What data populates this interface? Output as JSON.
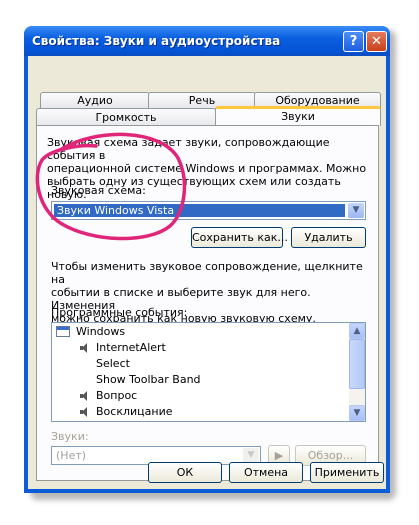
{
  "window": {
    "title": "Свойства: Звуки и аудиоустройства",
    "help_glyph": "?",
    "close_glyph": "✕"
  },
  "tabs": {
    "row_back": [
      "Аудио",
      "Речь",
      "Оборудование"
    ],
    "row_front": [
      "Громкость",
      "Звуки"
    ],
    "active": "Звуки"
  },
  "sounds_tab": {
    "intro": [
      "Звуковая схема задает звуки, сопровождающие события в",
      "операционной системе Windows и программах. Можно",
      "выбрать одну из существующих схем или создать новую."
    ],
    "scheme_label": "Звуковая схема:",
    "scheme_value": "Звуки Windows Vista",
    "save_as_label": "Сохранить как...",
    "delete_label": "Удалить",
    "instructions": [
      "Чтобы изменить звуковое сопровождение, щелкните на",
      "событии в списке и выберите звук для него. Изменения",
      "можно сохранить как новую звуковую схему."
    ],
    "events_label": "Программные события:",
    "events": [
      {
        "label": "Windows",
        "icon": "window-icon"
      },
      {
        "label": "InternetAlert",
        "icon": "speaker-icon"
      },
      {
        "label": "Select",
        "icon": ""
      },
      {
        "label": "Show Toolbar Band",
        "icon": ""
      },
      {
        "label": "Вопрос",
        "icon": "speaker-icon"
      },
      {
        "label": "Восклицание",
        "icon": "speaker-icon"
      }
    ],
    "sounds_label": "Звуки:",
    "sound_value": "(Нет)",
    "play_glyph": "▶",
    "browse_label": "Обзор..."
  },
  "footer": {
    "ok_label": "ОК",
    "cancel_label": "Отмена",
    "apply_label": "Применить"
  },
  "colors": {
    "title_bar": "#0553d4",
    "selection": "#316ac5",
    "tab_highlight": "#ffc83c",
    "annotation": "#e0257a"
  }
}
